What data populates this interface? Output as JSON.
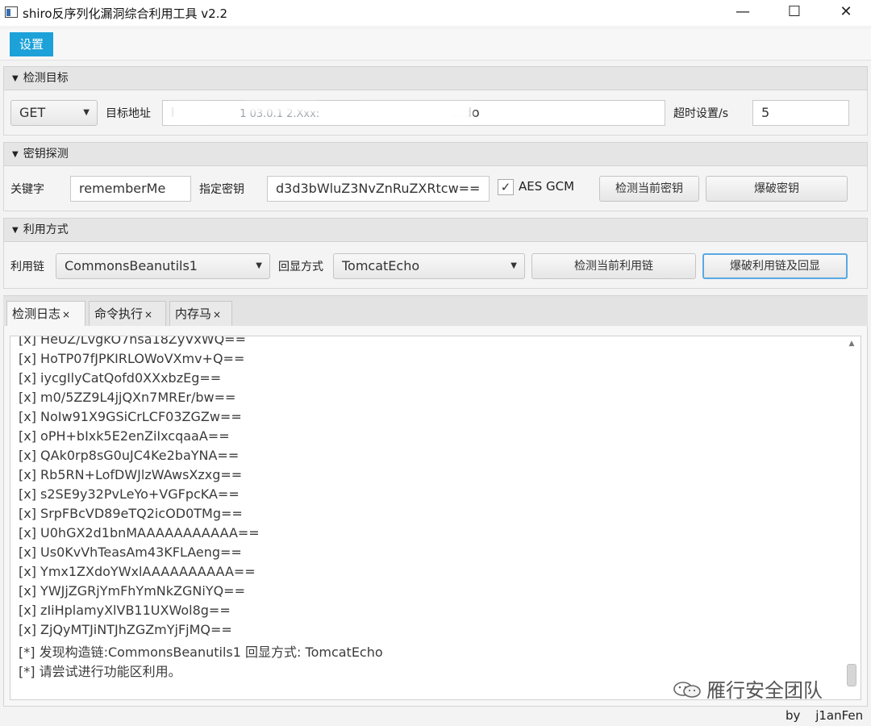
{
  "window": {
    "title": "shiro反序列化漏洞综合利用工具 v2.2",
    "min_glyph": "—",
    "max_glyph": "☐",
    "close_glyph": "✕"
  },
  "menu": {
    "settings": "设置"
  },
  "target_section": {
    "header": "检测目标",
    "method": "GET",
    "url_label": "目标地址",
    "url_visible_start": "h",
    "url_visible_mid": "1 03.0.1 2.Xxx:",
    "url_visible_end": "s.do",
    "timeout_label": "超时设置/s",
    "timeout_value": "5"
  },
  "key_section": {
    "header": "密钥探测",
    "keyword_label": "关键字",
    "keyword_value": "rememberMe",
    "key_label": "指定密钥",
    "key_value": "d3d3bWluZ3NvZnRuZXRtcw==",
    "aes_gcm_label": "AES GCM",
    "aes_gcm_checked": true,
    "detect_key_button": "检测当前密钥",
    "brute_key_button": "爆破密钥"
  },
  "exploit_section": {
    "header": "利用方式",
    "chain_label": "利用链",
    "chain_value": "CommonsBeanutils1",
    "echo_label": "回显方式",
    "echo_value": "TomcatEcho",
    "detect_chain_button": "检测当前利用链",
    "brute_chain_button": "爆破利用链及回显"
  },
  "tabs": [
    {
      "label": "检测日志",
      "active": true
    },
    {
      "label": "命令执行",
      "active": false
    },
    {
      "label": "内存马",
      "active": false
    }
  ],
  "tab_close": "×",
  "log": [
    "[x] HeUZ/LvgkO7nsa18ZyVxWQ==",
    "[x] HoTP07fJPKIRLOWoVXmv+Q==",
    "[x] iycgIlyCatQofd0XXxbzEg==",
    "[x] m0/5ZZ9L4jjQXn7MREr/bw==",
    "[x] NoIw91X9GSiCrLCF03ZGZw==",
    "[x] oPH+bIxk5E2enZiIxcqaaA==",
    "[x] QAk0rp8sG0uJC4Ke2baYNA==",
    "[x] Rb5RN+LofDWJlzWAwsXzxg==",
    "[x] s2SE9y32PvLeYo+VGFpcKA==",
    "[x] SrpFBcVD89eTQ2icOD0TMg==",
    "[x] U0hGX2d1bnMAAAAAAAAAAA==",
    "[x] Us0KvVhTeasAm43KFLAeng==",
    "[x] Ymx1ZXdoYWxlAAAAAAAAAA==",
    "[x] YWJjZGRjYmFhYmNkZGNiYQ==",
    "[x] zIiHplamyXlVB11UXWol8g==",
    "[x] ZjQyMTJiNTJhZGZmYjFjMQ==",
    "[*] 发现构造链:CommonsBeanutils1  回显方式: TomcatEcho",
    "[*] 请尝试进行功能区利用。"
  ],
  "watermark": "雁行安全团队",
  "footer": {
    "by": "by",
    "author": "j1anFen"
  },
  "colors": {
    "accent": "#1ca1d8",
    "focus_border": "#59a9e3"
  }
}
